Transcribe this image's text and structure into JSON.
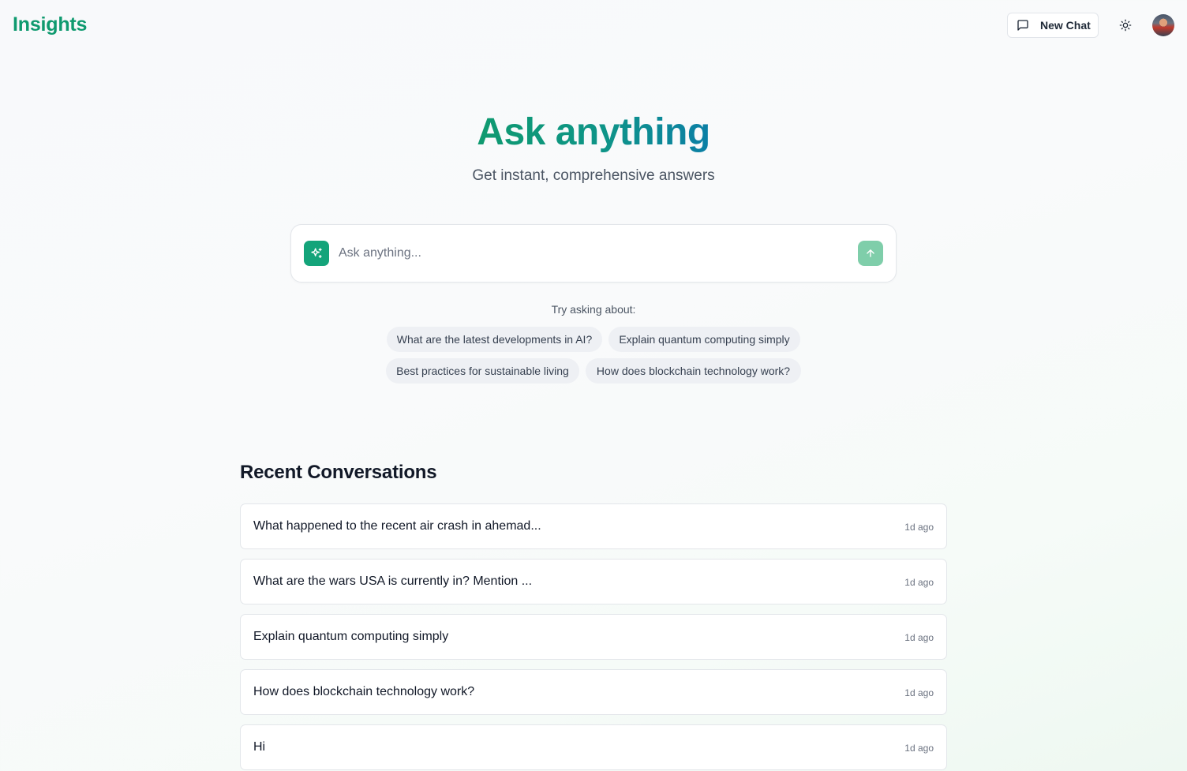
{
  "header": {
    "logo": "Insights",
    "new_chat_label": "New Chat",
    "new_chat_icon": "message-square-icon",
    "theme_icon": "sun-icon"
  },
  "hero": {
    "title": "Ask anything",
    "subtitle": "Get instant, comprehensive answers"
  },
  "search": {
    "placeholder": "Ask anything...",
    "value": "",
    "leading_icon": "sparkles-icon",
    "send_icon": "arrow-up-icon"
  },
  "suggestions": {
    "label": "Try asking about:",
    "items": [
      "What are the latest developments in AI?",
      "Explain quantum computing simply",
      "Best practices for sustainable living",
      "How does blockchain technology work?"
    ]
  },
  "recent": {
    "title": "Recent Conversations",
    "items": [
      {
        "title": "What happened to the recent air crash in ahemad...",
        "time": "1d ago"
      },
      {
        "title": "What are the wars USA is currently in? Mention ...",
        "time": "1d ago"
      },
      {
        "title": "Explain quantum computing simply",
        "time": "1d ago"
      },
      {
        "title": "How does blockchain technology work?",
        "time": "1d ago"
      },
      {
        "title": "Hi",
        "time": "1d ago"
      }
    ]
  },
  "colors": {
    "brand": "#0f9a6f",
    "accent": "#14a47a",
    "send_button": "#7fceaa",
    "chip_bg": "#eef0f4"
  }
}
